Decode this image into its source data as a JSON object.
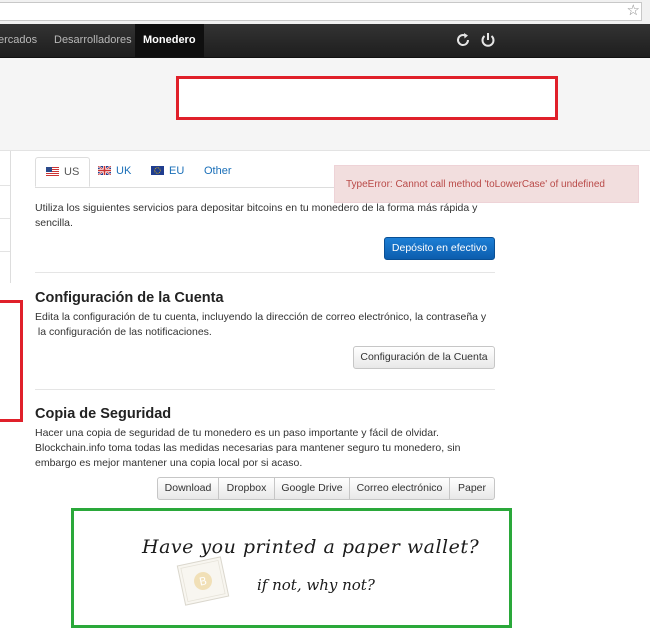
{
  "browser": {
    "bookmark_icon": "star-icon"
  },
  "navbar": {
    "items": [
      {
        "label": "ercados"
      },
      {
        "label": "Desarrolladores"
      },
      {
        "label": "Monedero"
      }
    ],
    "refresh_icon": "refresh-icon",
    "power_icon": "power-icon"
  },
  "tabs": [
    {
      "label": "US",
      "flag": "us-flag-icon"
    },
    {
      "label": "UK",
      "flag": "uk-flag-icon"
    },
    {
      "label": "EU",
      "flag": "eu-flag-icon"
    },
    {
      "label": "Other"
    }
  ],
  "error": {
    "message": "TypeError: Cannot call method 'toLowerCase' of undefined"
  },
  "deposit": {
    "line1": "Utiliza los siguientes servicios para depositar bitcoins en tu monedero de la forma más rápida y",
    "line2": "sencilla.",
    "button": "Depósito en efectivo"
  },
  "account": {
    "title": "Configuración de la Cuenta",
    "line1": "Edita la configuración de tu cuenta, incluyendo la dirección de correo electrónico, la contraseña y",
    "line2": " la configuración de las notificaciones.",
    "button": "Configuración de la Cuenta"
  },
  "backup": {
    "title": "Copia de Seguridad",
    "line1": "Hacer una copia de seguridad de tu monedero es un paso importante y fácil de olvidar.",
    "line2": "Blockchain.info toma todas las medidas necesarias para mantener seguro tu monedero, sin",
    "line3": "embargo es mejor mantener una copia local por si acaso.",
    "buttons": [
      "Download",
      "Dropbox",
      "Google Drive",
      "Correo electrónico",
      "Paper"
    ]
  },
  "promo": {
    "line1": "Have you printed a paper wallet?",
    "line2": "if not, why not?"
  },
  "colors": {
    "annotation_red": "#e0202a",
    "annotation_green": "#2aa83a",
    "primary_button": "#0c5dad",
    "link": "#1a6fb8",
    "error_bg": "#f2dede",
    "error_text": "#b94a48"
  }
}
